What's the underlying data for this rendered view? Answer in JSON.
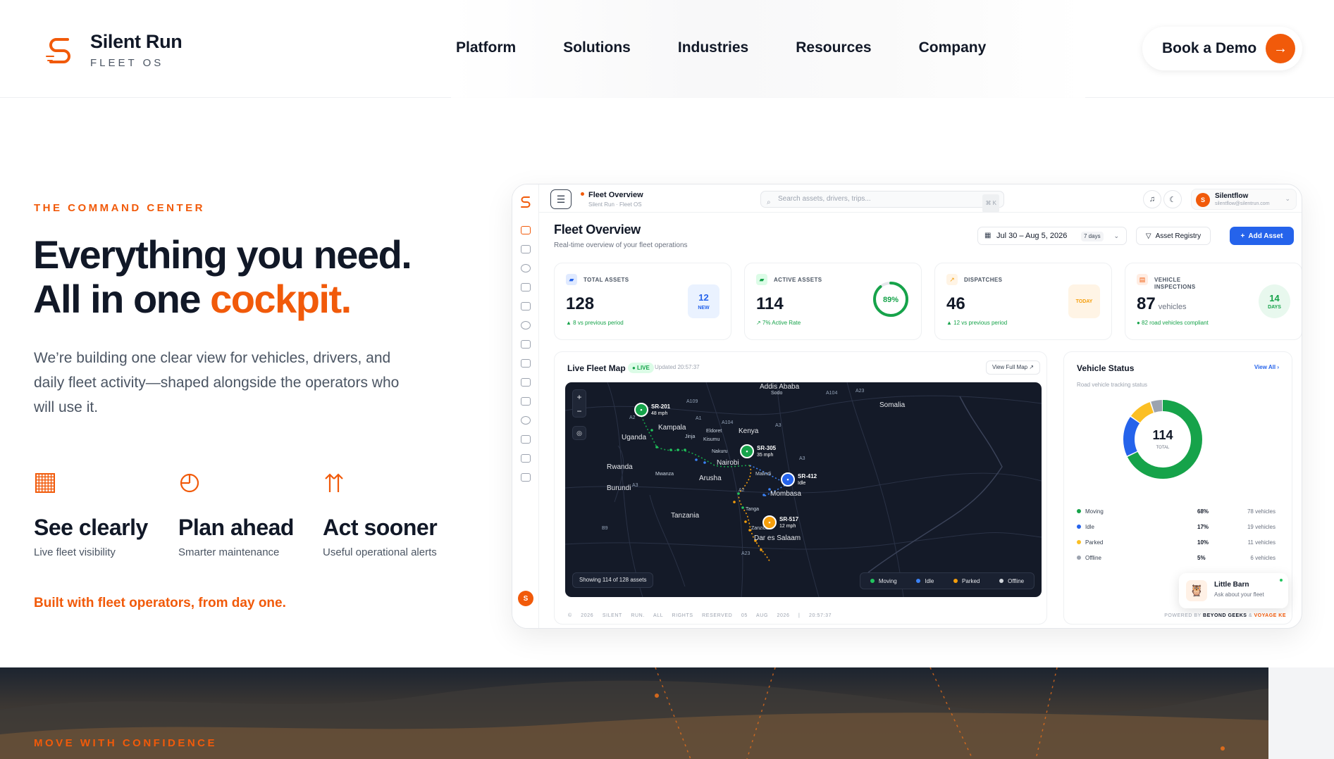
{
  "header": {
    "brand_name": "Silent Run",
    "brand_sub": "FLEET OS",
    "nav": [
      "Platform",
      "Solutions",
      "Industries",
      "Resources",
      "Company"
    ],
    "cta_label": "Book a Demo",
    "cta_icon": "arrow-right-icon"
  },
  "hero": {
    "eyebrow": "THE COMMAND CENTER",
    "headline_line1": "Everything you need.",
    "headline_line2_prefix": "All in one ",
    "headline_accent": "cockpit.",
    "lead": "We’re building one clear view for vehicles, drivers, and daily fleet activity—shaped alongside the operators who will use it.",
    "features": [
      {
        "icon": "grid-icon",
        "title": "See clearly",
        "subtitle": "Live fleet visibility"
      },
      {
        "icon": "clock-icon",
        "title": "Plan ahead",
        "subtitle": "Smarter maintenance"
      },
      {
        "icon": "arrows-up-icon",
        "title": "Act sooner",
        "subtitle": "Useful operational alerts"
      }
    ],
    "built_with": "Built with fleet operators, from day one."
  },
  "dashboard": {
    "crumb_title": "Fleet Overview",
    "crumb_sub": "Silent Run · Fleet OS",
    "search_placeholder": "Search assets, drivers, trips...",
    "search_kbd": "⌘ K",
    "user_name": "Silentflow",
    "user_email": "silentflow@silentrun.com",
    "user_initial": "S",
    "page_title": "Fleet Overview",
    "page_sub": "Real-time overview of your fleet operations",
    "date_range": "Jul 30 – Aug 5, 2026",
    "date_days": "7 days",
    "registry_label": "Asset Registry",
    "add_label": "Add Asset",
    "kpis": [
      {
        "label": "TOTAL ASSETS",
        "value": "128",
        "unit": "",
        "note": "▲ 8 vs previous period",
        "badge_top": "12",
        "badge_bottom": "NEW",
        "color": "#2563eb"
      },
      {
        "label": "ACTIVE ASSETS",
        "value": "114",
        "unit": "",
        "note": "↗ 7% Active Rate",
        "ring_text": "89%",
        "ring_value": 0.89,
        "color": "#16a34a"
      },
      {
        "label": "DISPATCHES",
        "value": "46",
        "unit": "",
        "note": "▲ 12 vs previous period",
        "badge_bottom": "TODAY",
        "color": "#f59e0b"
      },
      {
        "label": "VEHICLE INSPECTIONS",
        "value": "87",
        "unit": "vehicles",
        "note": "● 82 road vehicles compliant",
        "badge_top": "14",
        "badge_bottom": "DAYS",
        "color": "#16a34a"
      }
    ],
    "map": {
      "title": "Live Fleet Map",
      "live_label": "● LIVE",
      "updated": "Updated 20:57:37",
      "full_map_label": "View Full Map ↗",
      "places": [
        "Addis Ababa",
        "Somalia",
        "Kampala",
        "Uganda",
        "Kenya",
        "Nairobi",
        "Rwanda",
        "Burundi",
        "Arusha",
        "Mombasa",
        "Tanzania",
        "Tanga",
        "Dar es Salaam"
      ],
      "small_places": [
        "Jinja",
        "Eldoret",
        "Kisumu",
        "Nakuru",
        "Mwanza",
        "Malindi",
        "Zanzibar",
        "Sodo"
      ],
      "road_labels": [
        "A109",
        "A104",
        "A23",
        "A2",
        "A1",
        "A104",
        "A3",
        "A3",
        "B9",
        "A23",
        "A3",
        "A2"
      ],
      "vehicles": [
        {
          "id": "SR-201",
          "speed": "48 mph",
          "status": "Moving"
        },
        {
          "id": "SR-305",
          "speed": "35 mph",
          "status": "Moving"
        },
        {
          "id": "SR-412",
          "speed": "Idle",
          "status": "Idle"
        },
        {
          "id": "SR-517",
          "speed": "12 mph",
          "status": "Parked"
        }
      ],
      "showing": "Showing 114 of 128 assets",
      "legend": [
        {
          "label": "Moving",
          "color": "#22c55e"
        },
        {
          "label": "Idle",
          "color": "#3b82f6"
        },
        {
          "label": "Parked",
          "color": "#f59e0b"
        },
        {
          "label": "Offline",
          "color": "#d1d5db"
        }
      ]
    },
    "status": {
      "title": "Vehicle Status",
      "subtitle": "Road vehicle tracking status",
      "view_all": "View All ›",
      "total": "114",
      "total_label": "TOTAL",
      "rows": [
        {
          "name": "Moving",
          "pct": "68%",
          "count": "78 vehicles",
          "value": 68,
          "color": "#16a34a"
        },
        {
          "name": "Idle",
          "pct": "17%",
          "count": "19 vehicles",
          "value": 17,
          "color": "#2563eb"
        },
        {
          "name": "Parked",
          "pct": "10%",
          "count": "11 vehicles",
          "value": 10,
          "color": "#fbbf24"
        },
        {
          "name": "Offline",
          "pct": "5%",
          "count": "6 vehicles",
          "value": 5,
          "color": "#9ca3af"
        }
      ]
    },
    "assistant": {
      "name": "Little Barn",
      "subtitle": "Ask about your fleet",
      "icon": "owl-icon"
    },
    "footer_left": "© 2026 SILENT RUN.  ALL RIGHTS RESERVED  05 AUG 2026 | 20:57:37",
    "footer_powered": "POWERED BY ",
    "footer_beyond": "BEYOND GEEKS",
    "footer_amp": " & ",
    "footer_voyage": "VOYAGE KE"
  },
  "bottom": {
    "eyebrow": "MOVE WITH CONFIDENCE"
  }
}
